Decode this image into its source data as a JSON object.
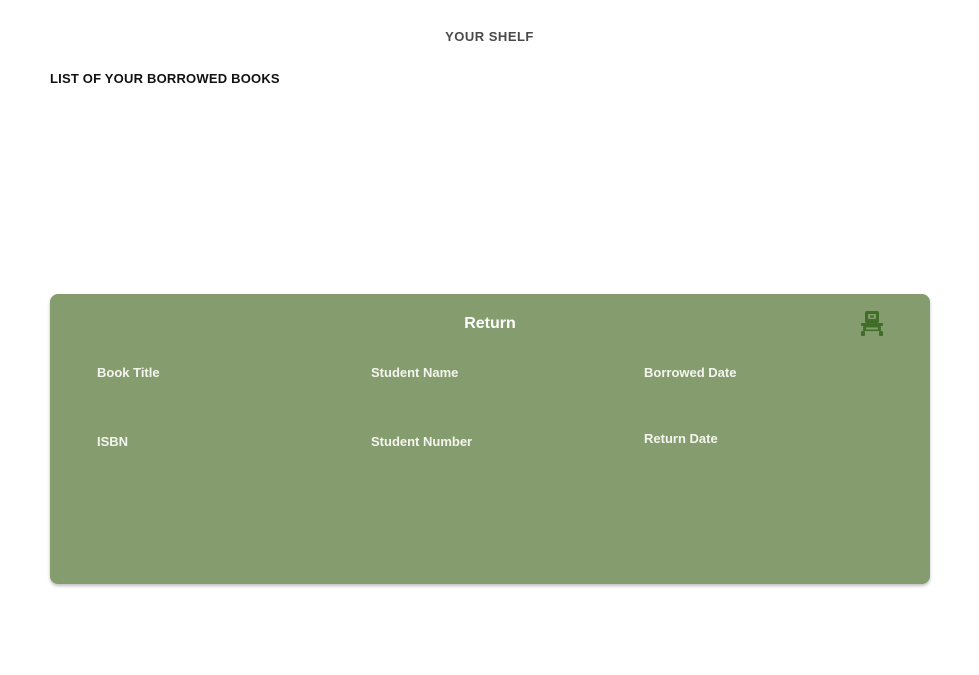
{
  "header": {
    "title": "YOUR SHELF"
  },
  "section": {
    "title": "LIST OF YOUR BORROWED BOOKS"
  },
  "card": {
    "title": "Return",
    "icon": "return-book-icon",
    "accent_color": "#859d6e",
    "fields": {
      "book_title": "Book Title",
      "student_name": "Student Name",
      "borrowed_date": "Borrowed Date",
      "isbn": "ISBN",
      "student_number": "Student Number",
      "return_date": "Return Date"
    }
  }
}
